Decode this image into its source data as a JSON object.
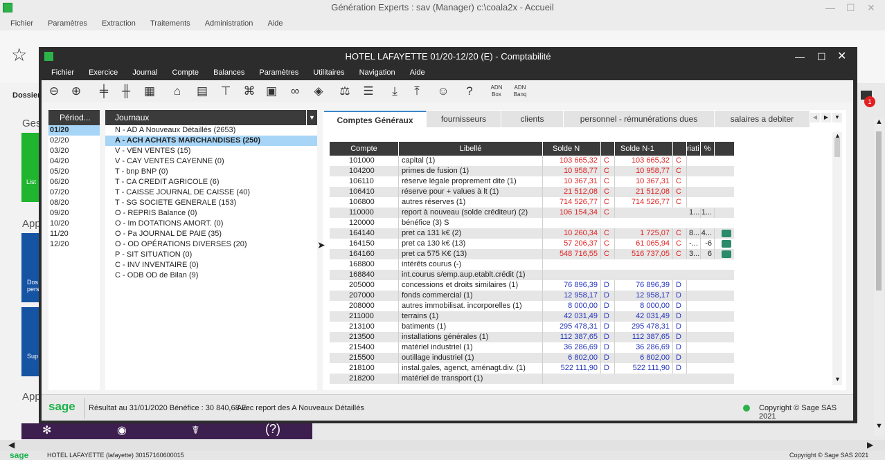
{
  "outer": {
    "title": "Génération Experts : sav (Manager) c:\\coala2x - Accueil",
    "menu": [
      "Fichier",
      "Paramètres",
      "Extraction",
      "Traitements",
      "Administration",
      "Aide"
    ],
    "side_labels": {
      "dossier": "Dossier",
      "ges": "Ges",
      "list": "List",
      "app1": "App",
      "dos": "Dos",
      "pers": "pers",
      "sup": "Sup",
      "app2": "App"
    },
    "bottom_left": "sage",
    "bottom_text": "HOTEL LAFAYETTE (lafayette) 30157160600015",
    "bottom_right": "Copyright © Sage SAS 2021",
    "notif_count": "1",
    "help_glyph": "(?)"
  },
  "window": {
    "title": "HOTEL LAFAYETTE 01/20-12/20 (E) - Comptabilité",
    "menu": [
      "Fichier",
      "Exercice",
      "Journal",
      "Compte",
      "Balances",
      "Paramètres",
      "Utilitaires",
      "Navigation",
      "Aide"
    ],
    "toolbar_text": {
      "adn_box": "ADN Box",
      "adn_banq": "ADN Banq"
    }
  },
  "periods": {
    "header": "Périod...",
    "items": [
      "01/20",
      "02/20",
      "03/20",
      "04/20",
      "05/20",
      "06/20",
      "07/20",
      "08/20",
      "09/20",
      "10/20",
      "11/20",
      "12/20"
    ],
    "selected": 0
  },
  "journals": {
    "header": "Journaux",
    "items": [
      "N - AD A Nouveaux Détaillés (2653)",
      "A - ACH ACHATS MARCHANDISES (250)",
      "V - VEN VENTES (15)",
      "V - CAY VENTES CAYENNE (0)",
      "T - bnp BNP (0)",
      "T - CA CREDIT AGRICOLE (6)",
      "T - CAISSE JOURNAL DE CAISSE (40)",
      "T - SG SOCIETE GENERALE (153)",
      "O - REPRIS Balance (0)",
      "O - Im DOTATIONS AMORT. (0)",
      "O - Pa JOURNAL DE PAIE (35)",
      "O - OD OPÉRATIONS DIVERSES (20)",
      "P - SIT SITUATION (0)",
      "C - INV INVENTAIRE (0)",
      "C - ODB OD de Bilan (9)"
    ],
    "selected": 1
  },
  "tabs": [
    "Comptes Généraux",
    "fournisseurs",
    "clients",
    "personnel - rémunérations dues",
    "salaires a debiter"
  ],
  "table": {
    "headers": {
      "compte": "Compte",
      "libelle": "Libellé",
      "solde_n": "Solde N",
      "solde_n1": "Solde N-1",
      "var": "riati",
      "pct": "%"
    },
    "rows": [
      {
        "compte": "101000",
        "libelle": "capital (1)",
        "sn": "103 665,32",
        "sns": "C",
        "sn1": "103 665,32",
        "sn1s": "C",
        "var": "",
        "pct": "",
        "flag": false,
        "col": "red"
      },
      {
        "compte": "104200",
        "libelle": "primes de fusion (1)",
        "sn": "10 958,77",
        "sns": "C",
        "sn1": "10 958,77",
        "sn1s": "C",
        "var": "",
        "pct": "",
        "flag": false,
        "col": "red"
      },
      {
        "compte": "106110",
        "libelle": "réserve légale proprement dite (1)",
        "sn": "10 367,31",
        "sns": "C",
        "sn1": "10 367,31",
        "sn1s": "C",
        "var": "",
        "pct": "",
        "flag": false,
        "col": "red"
      },
      {
        "compte": "106410",
        "libelle": "réserve pour + values à lt (1)",
        "sn": "21 512,08",
        "sns": "C",
        "sn1": "21 512,08",
        "sn1s": "C",
        "var": "",
        "pct": "",
        "flag": false,
        "col": "red"
      },
      {
        "compte": "106800",
        "libelle": "autres réserves (1)",
        "sn": "714 526,77",
        "sns": "C",
        "sn1": "714 526,77",
        "sn1s": "C",
        "var": "",
        "pct": "",
        "flag": false,
        "col": "red"
      },
      {
        "compte": "110000",
        "libelle": "report à nouveau (solde créditeur) (2)",
        "sn": "106 154,34",
        "sns": "C",
        "sn1": "",
        "sn1s": "",
        "var": "1...",
        "pct": "1...",
        "flag": false,
        "col": "red"
      },
      {
        "compte": "120000",
        "libelle": "bénéfice (3) S",
        "sn": "",
        "sns": "",
        "sn1": "",
        "sn1s": "",
        "var": "",
        "pct": "",
        "flag": false,
        "col": "red"
      },
      {
        "compte": "164140",
        "libelle": "pret ca 131 k€  (2)",
        "sn": "10 260,34",
        "sns": "C",
        "sn1": "1 725,07",
        "sn1s": "C",
        "var": "8...",
        "pct": "4...",
        "flag": true,
        "col": "red"
      },
      {
        "compte": "164150",
        "libelle": "pret ca 130 k€  (13)",
        "sn": "57 206,37",
        "sns": "C",
        "sn1": "61 065,94",
        "sn1s": "C",
        "var": "-...",
        "pct": "-6",
        "flag": true,
        "col": "red"
      },
      {
        "compte": "164160",
        "libelle": "pret ca 575 K€ (13)",
        "sn": "548 716,55",
        "sns": "C",
        "sn1": "516 737,05",
        "sn1s": "C",
        "var": "3...",
        "pct": "6",
        "flag": true,
        "col": "red"
      },
      {
        "compte": "168800",
        "libelle": "intérêts courus (-)",
        "sn": "",
        "sns": "",
        "sn1": "",
        "sn1s": "",
        "var": "",
        "pct": "",
        "flag": false,
        "col": "red"
      },
      {
        "compte": "168840",
        "libelle": "int.courus s/emp.aup.etablt.crédit (1)",
        "sn": "",
        "sns": "",
        "sn1": "",
        "sn1s": "",
        "var": "",
        "pct": "",
        "flag": false,
        "col": "red"
      },
      {
        "compte": "205000",
        "libelle": "concessions et droits similaires (1)",
        "sn": "76 896,39",
        "sns": "D",
        "sn1": "76 896,39",
        "sn1s": "D",
        "var": "",
        "pct": "",
        "flag": false,
        "col": "blue"
      },
      {
        "compte": "207000",
        "libelle": "fonds commercial (1)",
        "sn": "12 958,17",
        "sns": "D",
        "sn1": "12 958,17",
        "sn1s": "D",
        "var": "",
        "pct": "",
        "flag": false,
        "col": "blue"
      },
      {
        "compte": "208000",
        "libelle": "autres immobilisat. incorporelles (1)",
        "sn": "8 000,00",
        "sns": "D",
        "sn1": "8 000,00",
        "sn1s": "D",
        "var": "",
        "pct": "",
        "flag": false,
        "col": "blue"
      },
      {
        "compte": "211000",
        "libelle": "terrains (1)",
        "sn": "42 031,49",
        "sns": "D",
        "sn1": "42 031,49",
        "sn1s": "D",
        "var": "",
        "pct": "",
        "flag": false,
        "col": "blue"
      },
      {
        "compte": "213100",
        "libelle": "batiments (1)",
        "sn": "295 478,31",
        "sns": "D",
        "sn1": "295 478,31",
        "sn1s": "D",
        "var": "",
        "pct": "",
        "flag": false,
        "col": "blue"
      },
      {
        "compte": "213500",
        "libelle": "installations générales (1)",
        "sn": "112 387,65",
        "sns": "D",
        "sn1": "112 387,65",
        "sn1s": "D",
        "var": "",
        "pct": "",
        "flag": false,
        "col": "blue"
      },
      {
        "compte": "215400",
        "libelle": "matériel industriel (1)",
        "sn": "36 286,69",
        "sns": "D",
        "sn1": "36 286,69",
        "sn1s": "D",
        "var": "",
        "pct": "",
        "flag": false,
        "col": "blue"
      },
      {
        "compte": "215500",
        "libelle": "outillage industriel (1)",
        "sn": "6 802,00",
        "sns": "D",
        "sn1": "6 802,00",
        "sn1s": "D",
        "var": "",
        "pct": "",
        "flag": false,
        "col": "blue"
      },
      {
        "compte": "218100",
        "libelle": "instal.gales, agenct, aménagt.div. (1)",
        "sn": "522 111,90",
        "sns": "D",
        "sn1": "522 111,90",
        "sn1s": "D",
        "var": "",
        "pct": "",
        "flag": false,
        "col": "blue"
      },
      {
        "compte": "218200",
        "libelle": "matériel de transport (1)",
        "sn": "",
        "sns": "",
        "sn1": "",
        "sn1s": "",
        "var": "",
        "pct": "",
        "flag": false,
        "col": "blue"
      }
    ]
  },
  "status": {
    "logo": "sage",
    "result": "Résultat au 31/01/2020 Bénéfice : 30 840,68 E",
    "report": "Avec report des A Nouveaux Détaillés",
    "copyright": "Copyright © Sage SAS 2021"
  },
  "colors": {
    "red": "#e02020",
    "blue": "#2233bb",
    "accent": "#3a86c6",
    "selected": "#a6d5f7",
    "sage": "#1bb24b"
  }
}
